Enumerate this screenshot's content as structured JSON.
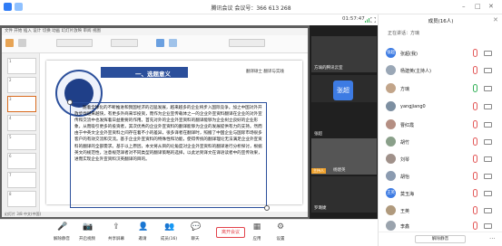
{
  "window": {
    "title": "腾讯会议 会议号：366 613 268"
  },
  "meeting": {
    "timer": "01:57:47"
  },
  "ppt": {
    "menu": "文件  开始  插入  设计  切换  动画  幻灯片放映  审阅  视图",
    "thumbs": [
      "1",
      "2",
      "3",
      "4",
      "5",
      "6",
      "7",
      "8"
    ],
    "slide_header": "一、选题意义",
    "right_header": "翻译硕士  翻译与实践",
    "paragraph": "随着全球化的不断推进和我国经济的迅猛发展，越来越多的企业将步入国际竞争。加之中国对外开放步伐越来越快，有更多外商来华投资，而作为企业宣传载体之一的企业外宣资料翻译在企业的对外宣传和交流中也发挥着日益重要的作用。首先对外的企业外宣资料的翻译能够为企业树立良好的企业形象，从而吸引更多的投资者，其次优秀的企业外宣资料的翻译能够为企业的发展提供有力的支持。然而由于中英文企业外宣资料之间存在着不小的差异，很多译者在翻译时，照搬了中国企业与国际市场很多客户的有效交流和交流。基于企业外宣资料的特殊性和功能，使得传统的翻译理论无法满足企业外宣资料的翻译的全部需求。基于以上原因，本文将从目的论角度对企业外宣资料的翻译进行分析探讨，根据英文的规范性，注意规范译者对不同类型的翻译策略的选择，以此达到译文在译语读者中的宣传效果，进而实现企业外宣资料汉英翻译的目的。",
    "status": "幻灯片 3/8  中文(中国)"
  },
  "video_tiles": [
    {
      "name": "方璃的腾讯云室",
      "avatar": ""
    },
    {
      "name": "张超",
      "avatar": "张超"
    },
    {
      "name": "张超",
      "avatar": ""
    },
    {
      "name": "杨建英",
      "avatar": "",
      "host": "主持人"
    },
    {
      "name": "罗璐婕",
      "avatar": ""
    }
  ],
  "toolbar": [
    {
      "label": "解除静音",
      "icon": "mic-icon"
    },
    {
      "label": "开启视频",
      "icon": "camera-icon"
    },
    {
      "label": "共享屏幕",
      "icon": "screen-share-icon"
    },
    {
      "label": "邀请",
      "icon": "invite-icon"
    },
    {
      "label": "成员(16)",
      "icon": "members-icon"
    },
    {
      "label": "聊天",
      "icon": "chat-icon"
    },
    {
      "label": "应用",
      "icon": "apps-icon"
    },
    {
      "label": "设置",
      "icon": "gear-icon"
    }
  ],
  "end_button": "离开会议",
  "members_panel": {
    "title": "成员(16人)",
    "subtitle": "正在讲话：方璃",
    "members": [
      {
        "avatar": "张超",
        "name": "张超(我)",
        "color": "#3d7be3"
      },
      {
        "avatar": "",
        "name": "杨建英(主持人)",
        "color": "#9aa7b6"
      },
      {
        "avatar": "",
        "name": "方璃",
        "color": "#c2a58a"
      },
      {
        "avatar": "",
        "name": "yangjiang0",
        "color": "#7d8fa1"
      },
      {
        "avatar": "",
        "name": "曹红霞",
        "color": "#b58f83"
      },
      {
        "avatar": "",
        "name": "胡竹",
        "color": "#8aa08a"
      },
      {
        "avatar": "",
        "name": "刘琴",
        "color": "#a0918a"
      },
      {
        "avatar": "",
        "name": "胡怡",
        "color": "#8b9bb0"
      },
      {
        "avatar": "王英",
        "name": "莫玉海",
        "color": "#3d7be3"
      },
      {
        "avatar": "",
        "name": "王英",
        "color": "#b09a7d"
      },
      {
        "avatar": "",
        "name": "李鑫",
        "color": "#9aa3ad"
      }
    ],
    "footer_button": "解除静音"
  }
}
